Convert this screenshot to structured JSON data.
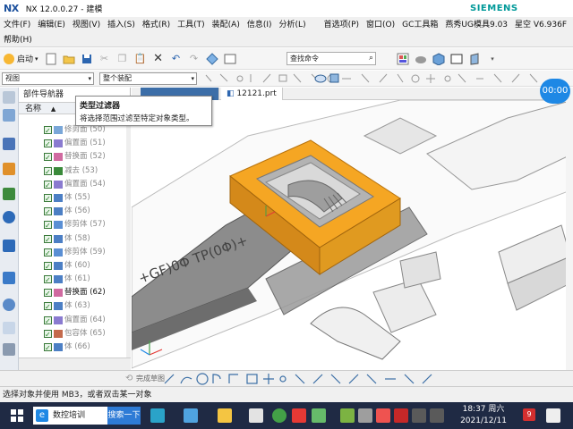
{
  "app": {
    "logo": "NX",
    "title": "NX 12.0.0.27 - 建模",
    "brand": "SIEMENS"
  },
  "menu": {
    "row1": [
      "文件(F)",
      "编辑(E)",
      "视图(V)",
      "插入(S)",
      "格式(R)",
      "工具(T)",
      "装配(A)",
      "信息(I)",
      "分析(L)",
      "首选项(P)",
      "窗口(O)",
      "GC工具箱",
      "燕秀UG模具9.03",
      "星空 V6.936F"
    ],
    "row2": [
      "帮助(H)"
    ]
  },
  "toolbar": {
    "start_label": "启动",
    "search_placeholder": "查找命令",
    "view_select": "视图",
    "assembly_select": "整个装配"
  },
  "navigator": {
    "title": "部件导航器",
    "column_name": "名称",
    "items": [
      {
        "label": "修剪面 (50)",
        "active": false,
        "icon": "trim-face-icon"
      },
      {
        "label": "偏置面 (51)",
        "active": false,
        "icon": "offset-face-icon"
      },
      {
        "label": "替换面 (52)",
        "active": false,
        "icon": "replace-face-icon"
      },
      {
        "label": "减去 (53)",
        "active": false,
        "icon": "subtract-icon"
      },
      {
        "label": "偏置面 (54)",
        "active": false,
        "icon": "offset-face-icon"
      },
      {
        "label": "体 (55)",
        "active": false,
        "icon": "body-icon"
      },
      {
        "label": "体 (56)",
        "active": false,
        "icon": "body-icon"
      },
      {
        "label": "修剪体 (57)",
        "active": false,
        "icon": "trim-body-icon"
      },
      {
        "label": "体 (58)",
        "active": false,
        "icon": "body-icon"
      },
      {
        "label": "修剪体 (59)",
        "active": false,
        "icon": "trim-body-icon"
      },
      {
        "label": "体 (60)",
        "active": false,
        "icon": "body-icon"
      },
      {
        "label": "体 (61)",
        "active": false,
        "icon": "body-icon"
      },
      {
        "label": "替换面 (62)",
        "active": true,
        "icon": "replace-face-icon"
      },
      {
        "label": "体 (63)",
        "active": false,
        "icon": "body-icon"
      },
      {
        "label": "偏置面 (64)",
        "active": false,
        "icon": "offset-face-icon"
      },
      {
        "label": "包容体 (65)",
        "active": false,
        "icon": "bounding-body-icon"
      },
      {
        "label": "体 (66)",
        "active": false,
        "icon": "body-icon"
      }
    ]
  },
  "tooltip": {
    "title": "类型过滤器",
    "body": "将选择范围过滤至特定对象类型。"
  },
  "graphics": {
    "tab_file": "12121.prt",
    "timer": "00:00",
    "engraved_text": "+GF)0Φ TP(0Φ)+"
  },
  "selection_bar": {
    "complete_sketch": "完成草图"
  },
  "status": {
    "message": "选择对象并使用 MB3，或者双击某一对象"
  },
  "taskbar": {
    "search_text": "数控培训",
    "search_button": "搜索一下",
    "time": "18:37 周六",
    "date": "2021/12/11",
    "notification_count": "9"
  },
  "colors": {
    "accent": "#1e88e5",
    "model_orange": "#f5a623",
    "model_gray": "#8c8c8c",
    "siemens": "#009999"
  }
}
